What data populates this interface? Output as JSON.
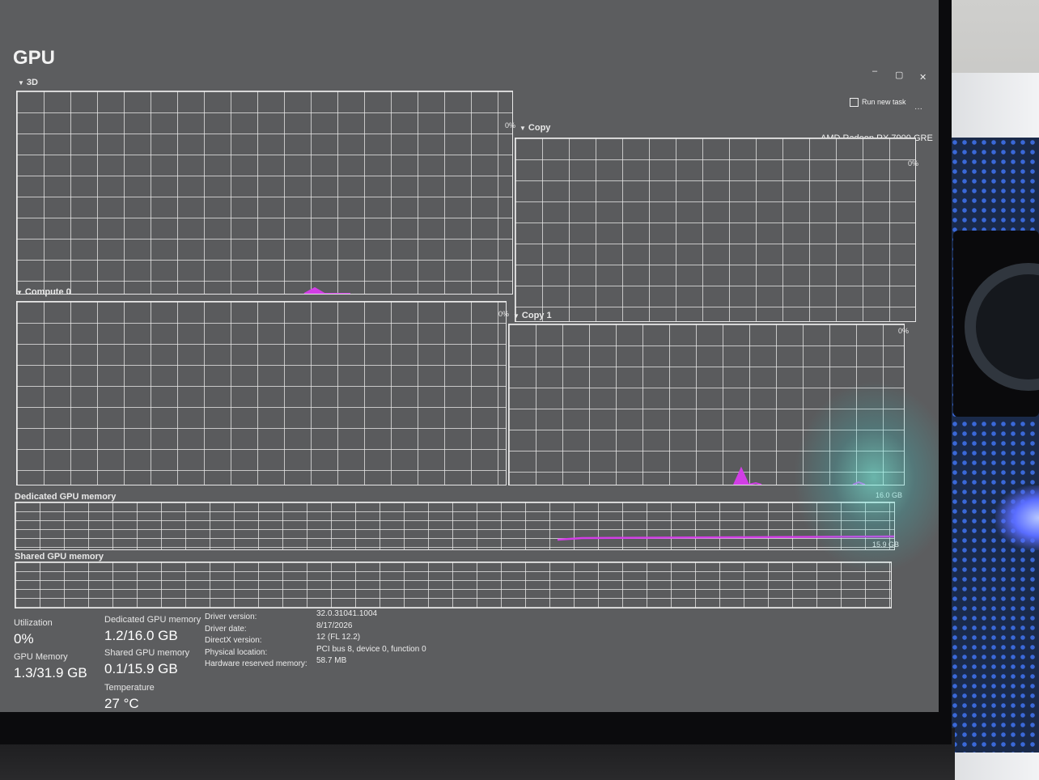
{
  "page": {
    "title": "GPU"
  },
  "window": {
    "minimize_label": "–",
    "maximize_label": "▢",
    "close_label": "✕",
    "run_new_task_label": "Run new task",
    "more_label": "···"
  },
  "gpu": {
    "device_name": "AMD Radeon RX 7900 GRE"
  },
  "engines": [
    {
      "name": "3D",
      "scale_max": "0%"
    },
    {
      "name": "Copy",
      "scale_max": "0%"
    },
    {
      "name": "Compute 0",
      "scale_max": "0%"
    },
    {
      "name": "Copy 1",
      "scale_max": "0%"
    }
  ],
  "memory": {
    "dedicated_label": "Dedicated GPU memory",
    "dedicated_max": "16.0 GB",
    "shared_label": "Shared GPU memory",
    "shared_max": "15.9 GB"
  },
  "stats": {
    "utilization_label": "Utilization",
    "utilization_value": "0%",
    "gpu_memory_label": "GPU Memory",
    "gpu_memory_value": "1.3/31.9 GB",
    "dedicated_label": "Dedicated GPU memory",
    "dedicated_value": "1.2/16.0 GB",
    "shared_label": "Shared GPU memory",
    "shared_value": "0.1/15.9 GB",
    "temperature_label": "Temperature",
    "temperature_value": "27 °C"
  },
  "details": [
    {
      "label": "Driver version:",
      "value": "32.0.31041.1004"
    },
    {
      "label": "Driver date:",
      "value": "8/17/2026"
    },
    {
      "label": "DirectX version:",
      "value": "12 (FL 12.2)"
    },
    {
      "label": "Physical location:",
      "value": "PCI bus 8, device 0, function 0"
    },
    {
      "label": "Hardware reserved memory:",
      "value": "58.7 MB"
    }
  ],
  "colors": {
    "accent": "#d23ee6",
    "screen_bg": "#5c5d5f",
    "grid": "#e8e8e8"
  }
}
